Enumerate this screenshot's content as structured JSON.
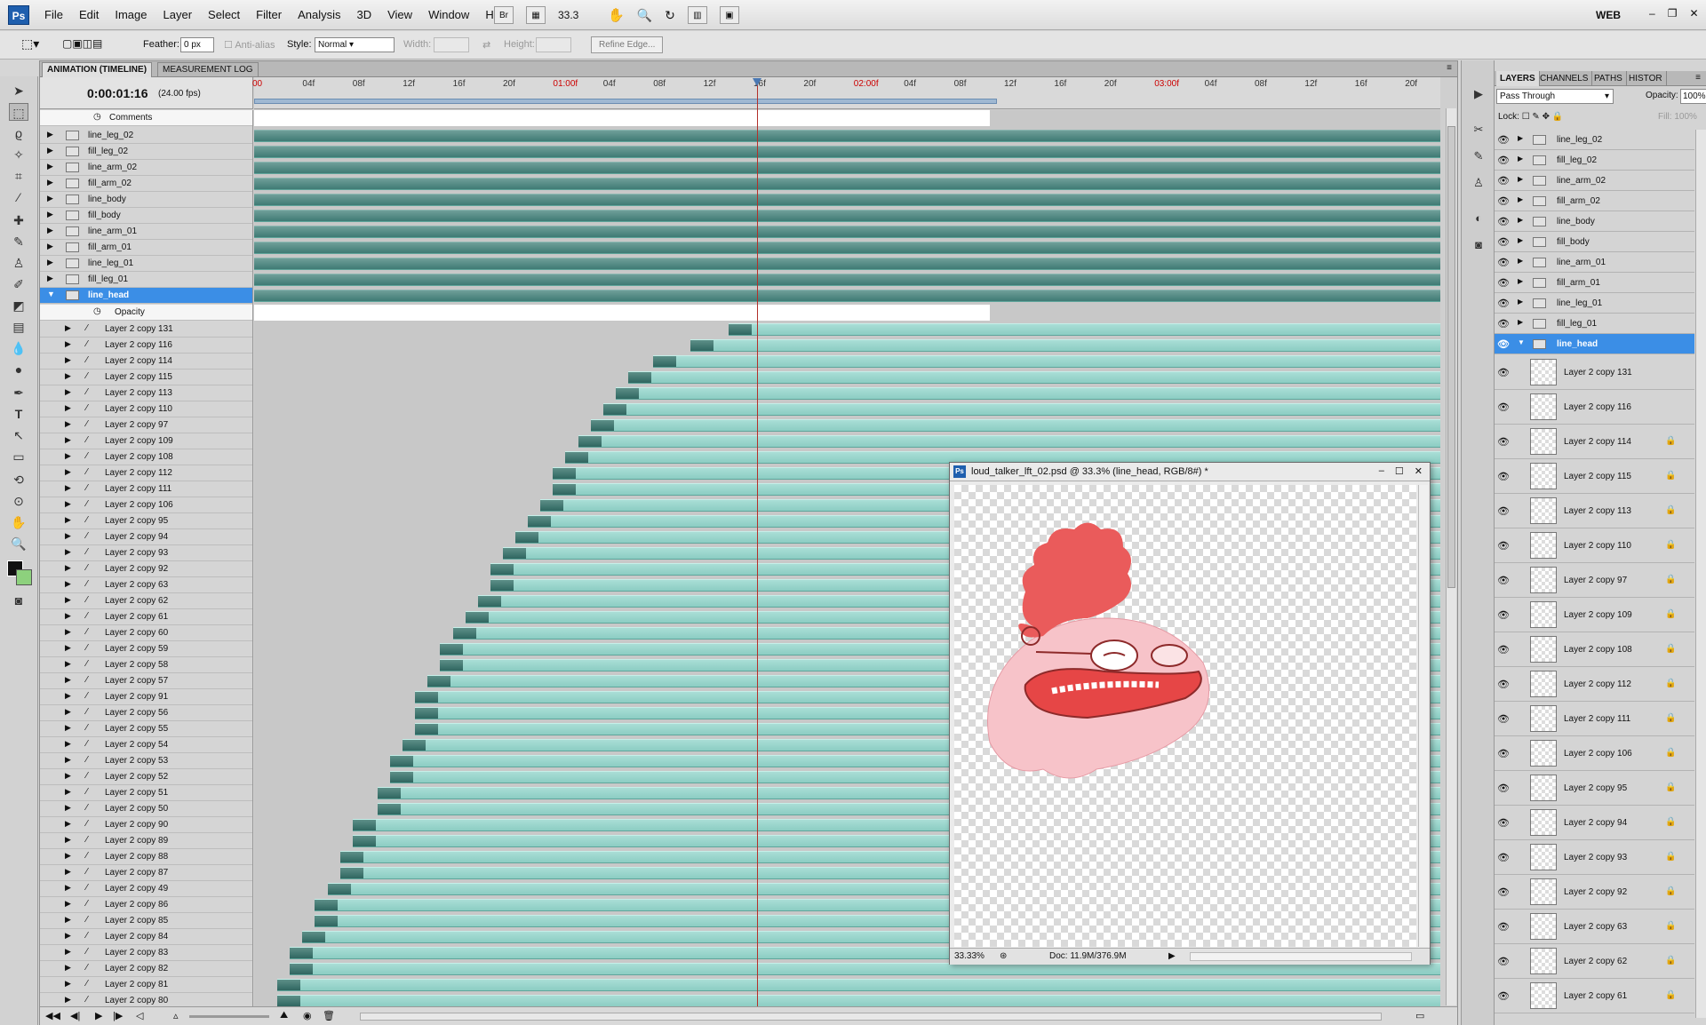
{
  "app": {
    "logo": "Ps",
    "menus": [
      "File",
      "Edit",
      "Image",
      "Layer",
      "Select",
      "Filter",
      "Analysis",
      "3D",
      "View",
      "Window",
      "Help"
    ],
    "zoom": "33.3",
    "workspace": "WEB",
    "bridge": "Br"
  },
  "options": {
    "feather_label": "Feather:",
    "feather_value": "0 px",
    "antialias": "Anti-alias",
    "style_label": "Style:",
    "style_value": "Normal",
    "width_label": "Width:",
    "height_label": "Height:",
    "refine_edge": "Refine Edge..."
  },
  "timeline": {
    "tabs": [
      "ANIMATION (TIMELINE)",
      "MEASUREMENT LOG"
    ],
    "timecode": "0:00:01:16",
    "fps": "(24.00 fps)",
    "ruler": [
      {
        "t": "00",
        "red": true
      },
      {
        "t": "04f"
      },
      {
        "t": "08f"
      },
      {
        "t": "12f"
      },
      {
        "t": "16f"
      },
      {
        "t": "20f"
      },
      {
        "t": "01:00f",
        "red": true
      },
      {
        "t": "04f"
      },
      {
        "t": "08f"
      },
      {
        "t": "12f"
      },
      {
        "t": "16f"
      },
      {
        "t": "20f"
      },
      {
        "t": "02:00f",
        "red": true
      },
      {
        "t": "04f"
      },
      {
        "t": "08f"
      },
      {
        "t": "12f"
      },
      {
        "t": "16f"
      },
      {
        "t": "20f"
      },
      {
        "t": "03:00f",
        "red": true
      },
      {
        "t": "04f"
      },
      {
        "t": "08f"
      },
      {
        "t": "12f"
      },
      {
        "t": "16f"
      },
      {
        "t": "20f"
      }
    ],
    "comments_label": "Comments",
    "opacity_label": "Opacity",
    "groups": [
      "line_leg_02",
      "fill_leg_02",
      "line_arm_02",
      "fill_arm_02",
      "line_body",
      "fill_body",
      "line_arm_01",
      "fill_arm_01",
      "line_leg_01",
      "fill_leg_01"
    ],
    "open_group": "line_head",
    "layers": [
      {
        "n": "Layer 2 copy 131",
        "f": 37
      },
      {
        "n": "Layer 2 copy 116",
        "f": 34
      },
      {
        "n": "Layer 2 copy 114",
        "f": 31
      },
      {
        "n": "Layer 2 copy 115",
        "f": 29
      },
      {
        "n": "Layer 2 copy 113",
        "f": 28
      },
      {
        "n": "Layer 2 copy 110",
        "f": 27
      },
      {
        "n": "Layer 2 copy 97",
        "f": 26
      },
      {
        "n": "Layer 2 copy 109",
        "f": 25
      },
      {
        "n": "Layer 2 copy 108",
        "f": 24
      },
      {
        "n": "Layer 2 copy 112",
        "f": 23
      },
      {
        "n": "Layer 2 copy 111",
        "f": 23
      },
      {
        "n": "Layer 2 copy 106",
        "f": 22
      },
      {
        "n": "Layer 2 copy 95",
        "f": 21
      },
      {
        "n": "Layer 2 copy 94",
        "f": 20
      },
      {
        "n": "Layer 2 copy 93",
        "f": 19
      },
      {
        "n": "Layer 2 copy 92",
        "f": 18
      },
      {
        "n": "Layer 2 copy 63",
        "f": 18
      },
      {
        "n": "Layer 2 copy 62",
        "f": 17
      },
      {
        "n": "Layer 2 copy 61",
        "f": 16
      },
      {
        "n": "Layer 2 copy 60",
        "f": 15
      },
      {
        "n": "Layer 2 copy 59",
        "f": 14
      },
      {
        "n": "Layer 2 copy 58",
        "f": 14
      },
      {
        "n": "Layer 2 copy 57",
        "f": 13
      },
      {
        "n": "Layer 2 copy 91",
        "f": 12
      },
      {
        "n": "Layer 2 copy 56",
        "f": 12
      },
      {
        "n": "Layer 2 copy 55",
        "f": 12
      },
      {
        "n": "Layer 2 copy 54",
        "f": 11
      },
      {
        "n": "Layer 2 copy 53",
        "f": 10
      },
      {
        "n": "Layer 2 copy 52",
        "f": 10
      },
      {
        "n": "Layer 2 copy 51",
        "f": 9
      },
      {
        "n": "Layer 2 copy 50",
        "f": 9
      },
      {
        "n": "Layer 2 copy 90",
        "f": 7
      },
      {
        "n": "Layer 2 copy 89",
        "f": 7
      },
      {
        "n": "Layer 2 copy 88",
        "f": 6
      },
      {
        "n": "Layer 2 copy 87",
        "f": 6
      },
      {
        "n": "Layer 2 copy 49",
        "f": 5
      },
      {
        "n": "Layer 2 copy 86",
        "f": 4
      },
      {
        "n": "Layer 2 copy 85",
        "f": 4
      },
      {
        "n": "Layer 2 copy 84",
        "f": 3
      },
      {
        "n": "Layer 2 copy 83",
        "f": 2
      },
      {
        "n": "Layer 2 copy 82",
        "f": 2
      },
      {
        "n": "Layer 2 copy 81",
        "f": 1
      },
      {
        "n": "Layer 2 copy 80",
        "f": 1
      }
    ]
  },
  "document": {
    "title": "loud_talker_lft_02.psd @ 33.3% (line_head, RGB/8#) *",
    "zoom": "33.33%",
    "doc": "Doc: 11.9M/376.9M"
  },
  "layers_panel": {
    "tabs": [
      "LAYERS",
      "CHANNELS",
      "PATHS",
      "HISTOR"
    ],
    "blend": "Pass Through",
    "opacity_label": "Opacity:",
    "opacity": "100%",
    "lock_label": "Lock:",
    "fill_label": "Fill:",
    "fill": "100%",
    "groups": [
      "line_leg_02",
      "fill_leg_02",
      "line_arm_02",
      "fill_arm_02",
      "line_body",
      "fill_body",
      "line_arm_01",
      "fill_arm_01",
      "line_leg_01",
      "fill_leg_01"
    ],
    "selected": "line_head",
    "layers": [
      "Layer 2 copy 131",
      "Layer 2 copy 116",
      "Layer 2 copy 114",
      "Layer 2 copy 115",
      "Layer 2 copy 113",
      "Layer 2 copy 110",
      "Layer 2 copy 97",
      "Layer 2 copy 109",
      "Layer 2 copy 108",
      "Layer 2 copy 112",
      "Layer 2 copy 111",
      "Layer 2 copy 106",
      "Layer 2 copy 95",
      "Layer 2 copy 94",
      "Layer 2 copy 93",
      "Layer 2 copy 92",
      "Layer 2 copy 63",
      "Layer 2 copy 62",
      "Layer 2 copy 61"
    ],
    "unlocked": [
      "Layer 2 copy 131",
      "Layer 2 copy 116"
    ]
  }
}
